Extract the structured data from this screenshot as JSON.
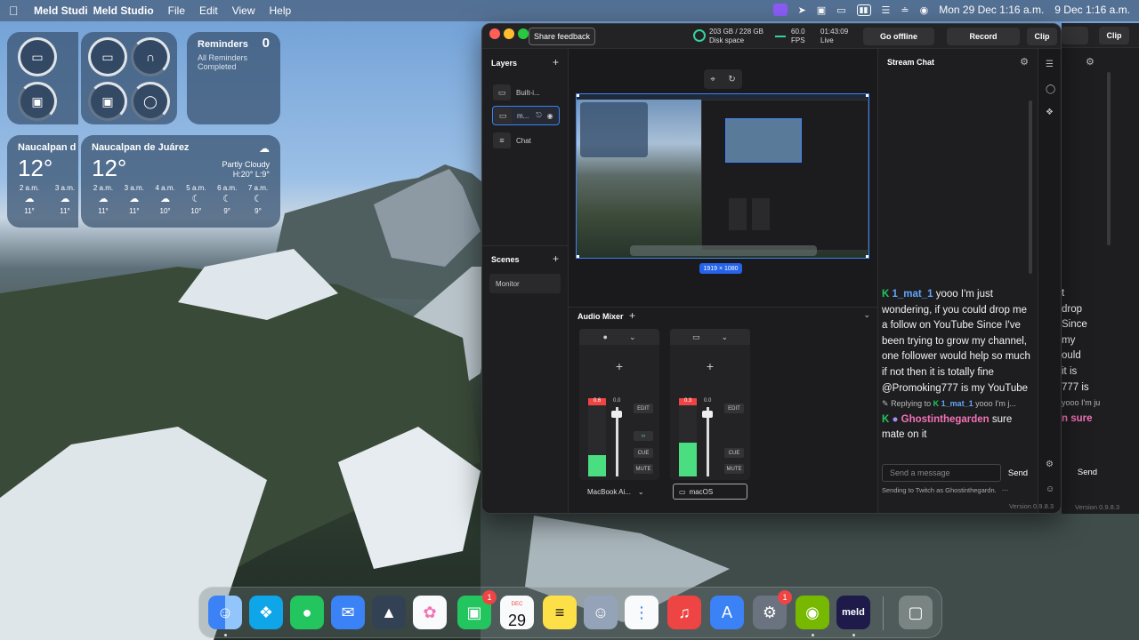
{
  "menubar": {
    "app_name": "Meld Studio",
    "ghost_app_name": "Meld Studi",
    "items": [
      "File",
      "Edit",
      "View",
      "Help"
    ],
    "datetime": "Mon 29 Dec  1:16 a.m.",
    "ghost_datetime": "9 Dec  1:16 a.m."
  },
  "widgets": {
    "reminders": {
      "title": "Reminders",
      "count": "0",
      "subtitle": "All Reminders Completed"
    },
    "weather": {
      "city": "Naucalpan de Juárez",
      "ghost_city": "Naucalpan d",
      "temp": "12°",
      "condition": "Partly Cloudy",
      "hilo": "H:20° L:9°",
      "hours": [
        {
          "time": "2 a.m.",
          "temp": "11°"
        },
        {
          "time": "3 a.m.",
          "temp": "11°"
        },
        {
          "time": "4 a.m.",
          "temp": "10°"
        },
        {
          "time": "5 a.m.",
          "temp": "10°"
        },
        {
          "time": "6 a.m.",
          "temp": "9°"
        },
        {
          "time": "7 a.m.",
          "temp": "9°"
        }
      ]
    }
  },
  "toolbar": {
    "share_feedback": "Share feedback",
    "disk_line1": "203 GB / 228 GB",
    "disk_line2": "Disk space",
    "fps_line1": "60.0",
    "fps_line2": "FPS",
    "live_line1": "01:43:09",
    "live_line2": "Live",
    "go_offline": "Go offline",
    "record": "Record",
    "clip": "Clip"
  },
  "layers": {
    "title": "Layers",
    "items": [
      {
        "label": "Built-i..."
      },
      {
        "label": "m..."
      },
      {
        "label": "Chat"
      }
    ]
  },
  "scenes": {
    "title": "Scenes",
    "items": [
      {
        "label": "Monitor"
      }
    ]
  },
  "canvas": {
    "dimensions": "1919 × 1080"
  },
  "mixer": {
    "title": "Audio Mixer",
    "channels": [
      {
        "peak": "0.6",
        "level": "0.0",
        "select": "MacBook Ai...",
        "scale": [
          "36",
          "42",
          "48",
          "54"
        ]
      },
      {
        "peak": "0.3",
        "level": "0.0",
        "select": "macOS",
        "scale": [
          "36",
          "42",
          "48",
          "54"
        ]
      }
    ],
    "edit": "EDIT",
    "cue": "CUE",
    "mute": "MUTE"
  },
  "chat": {
    "title": "Stream Chat",
    "msg1_user": "1_mat_1",
    "msg1_text": " yooo I'm just wondering, if you could drop me a follow on YouTube Since I've been trying to grow my channel, one follower would help so much if not then it is totally fine @Promoking777 is my YouTube",
    "reply_prefix": "Replying to",
    "reply_user": "1_mat_1",
    "reply_text": "yooo I'm j...",
    "msg2_user": "Ghostinthegarden",
    "msg2_text": " sure mate on it",
    "input_placeholder": "Send a message",
    "send": "Send",
    "sending_to": "Sending to Twitch as Ghostinthegardn.",
    "version": "Version 0.9.8.3"
  },
  "ghost_chat": {
    "lines": [
      "t",
      "drop",
      "Since",
      "my",
      "ould",
      "it is",
      "777 is"
    ],
    "reply_text": "yooo I'm ju",
    "sure": "n sure",
    "send": "Send",
    "version": "Version 0.9.8.3",
    "clip": "Clip"
  },
  "dock": {
    "calendar_month": "DEC",
    "calendar_day": "29",
    "facetime_badge": "1",
    "settings_badge": "1",
    "meld_label": "meld"
  }
}
